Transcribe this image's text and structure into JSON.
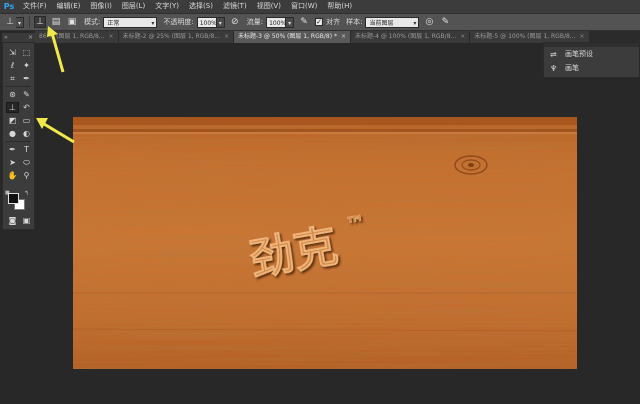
{
  "app": {
    "logo": "Ps"
  },
  "menu": [
    "文件(F)",
    "编辑(E)",
    "图像(I)",
    "图层(L)",
    "文字(Y)",
    "选择(S)",
    "滤镜(T)",
    "视图(V)",
    "窗口(W)",
    "帮助(H)"
  ],
  "options": {
    "mode_label": "模式:",
    "mode_value": "正常",
    "opacity_label": "不透明度:",
    "opacity_value": "100%",
    "flow_label": "流量:",
    "flow_value": "100%",
    "align_label": "对齐",
    "sample_label": "样本:",
    "sample_value": "当前图层"
  },
  "tabs": [
    {
      "label": "86 % (图层 1, RGB/8...",
      "active": false
    },
    {
      "label": "未标题-2 @ 25% (图层 1, RGB/8...",
      "active": false
    },
    {
      "label": "未标题-3 @ 50% (图层 1, RGB/8) *",
      "active": true
    },
    {
      "label": "未标题-4 @ 100% (图层 1, RGB/8...",
      "active": false
    },
    {
      "label": "未标题-5 @ 100% (图层 1, RGB/8...",
      "active": false
    }
  ],
  "canvas": {
    "embossed_text": "劲克",
    "embossed_mark": "™"
  },
  "right_panel": {
    "items": [
      {
        "label": "画笔预设",
        "icon": "brush-presets-icon"
      },
      {
        "label": "画笔",
        "icon": "brush-icon"
      }
    ]
  },
  "colors": {
    "foreground": "#111111",
    "background": "#ffffff",
    "wood_base": "#c46a2a",
    "arrow": "#f1e94a"
  }
}
